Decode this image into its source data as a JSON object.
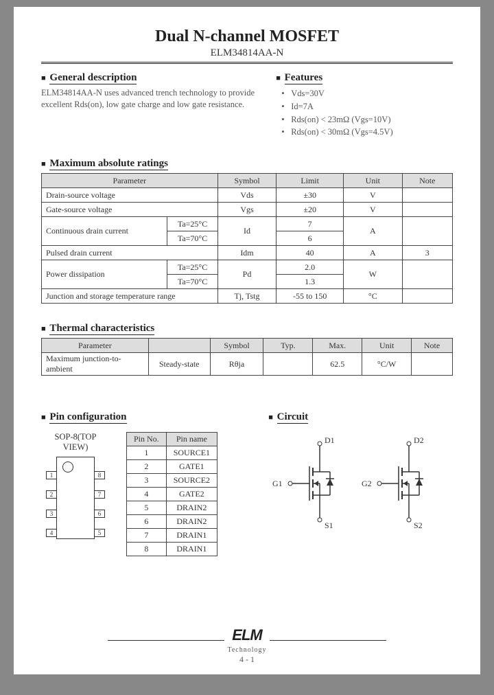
{
  "header": {
    "title": "Dual N-channel MOSFET",
    "part_number": "ELM34814AA-N"
  },
  "general": {
    "heading": "General description",
    "text": "ELM34814AA-N uses advanced trench technology to provide excellent Rds(on), low gate charge and low gate resistance."
  },
  "features": {
    "heading": "Features",
    "items": [
      "Vds=30V",
      "Id=7A",
      "Rds(on) < 23mΩ (Vgs=10V)",
      "Rds(on) < 30mΩ (Vgs=4.5V)"
    ]
  },
  "max_ratings": {
    "heading": "Maximum absolute ratings",
    "cols": [
      "Parameter",
      "Symbol",
      "Limit",
      "Unit",
      "Note"
    ],
    "rows": [
      {
        "param": "Drain-source voltage",
        "cond": "",
        "symbol": "Vds",
        "limit": "±30",
        "unit": "V",
        "note": ""
      },
      {
        "param": "Gate-source voltage",
        "cond": "",
        "symbol": "Vgs",
        "limit": "±20",
        "unit": "V",
        "note": ""
      },
      {
        "param": "Continuous drain current",
        "cond": "Ta=25°C",
        "symbol": "Id",
        "limit": "7",
        "unit": "A",
        "note": ""
      },
      {
        "param": "",
        "cond": "Ta=70°C",
        "symbol": "",
        "limit": "6",
        "unit": "",
        "note": ""
      },
      {
        "param": "Pulsed drain current",
        "cond": "",
        "symbol": "Idm",
        "limit": "40",
        "unit": "A",
        "note": "3"
      },
      {
        "param": "Power dissipation",
        "cond": "Ta=25°C",
        "symbol": "Pd",
        "limit": "2.0",
        "unit": "W",
        "note": ""
      },
      {
        "param": "",
        "cond": "Ta=70°C",
        "symbol": "",
        "limit": "1.3",
        "unit": "",
        "note": ""
      },
      {
        "param": "Junction and storage temperature range",
        "cond": "",
        "symbol": "Tj, Tstg",
        "limit": "-55 to 150",
        "unit": "°C",
        "note": ""
      }
    ]
  },
  "thermal": {
    "heading": "Thermal characteristics",
    "cols": [
      "Parameter",
      "",
      "Symbol",
      "Typ.",
      "Max.",
      "Unit",
      "Note"
    ],
    "row": {
      "param": "Maximum junction-to-ambient",
      "cond": "Steady-state",
      "symbol": "Rθja",
      "typ": "",
      "max": "62.5",
      "unit": "°C/W",
      "note": ""
    }
  },
  "pin_config": {
    "heading": "Pin configuration",
    "package_view": "SOP-8(TOP VIEW)",
    "cols": [
      "Pin No.",
      "Pin name"
    ],
    "pins": [
      {
        "no": "1",
        "name": "SOURCE1"
      },
      {
        "no": "2",
        "name": "GATE1"
      },
      {
        "no": "3",
        "name": "SOURCE2"
      },
      {
        "no": "4",
        "name": "GATE2"
      },
      {
        "no": "5",
        "name": "DRAIN2"
      },
      {
        "no": "6",
        "name": "DRAIN2"
      },
      {
        "no": "7",
        "name": "DRAIN1"
      },
      {
        "no": "8",
        "name": "DRAIN1"
      }
    ]
  },
  "circuit": {
    "heading": "Circuit",
    "labels": {
      "d1": "D1",
      "d2": "D2",
      "g1": "G1",
      "g2": "G2",
      "s1": "S1",
      "s2": "S2"
    }
  },
  "footer": {
    "logo_text": "ELM",
    "logo_sub": "Technology",
    "page": "4 - 1"
  }
}
